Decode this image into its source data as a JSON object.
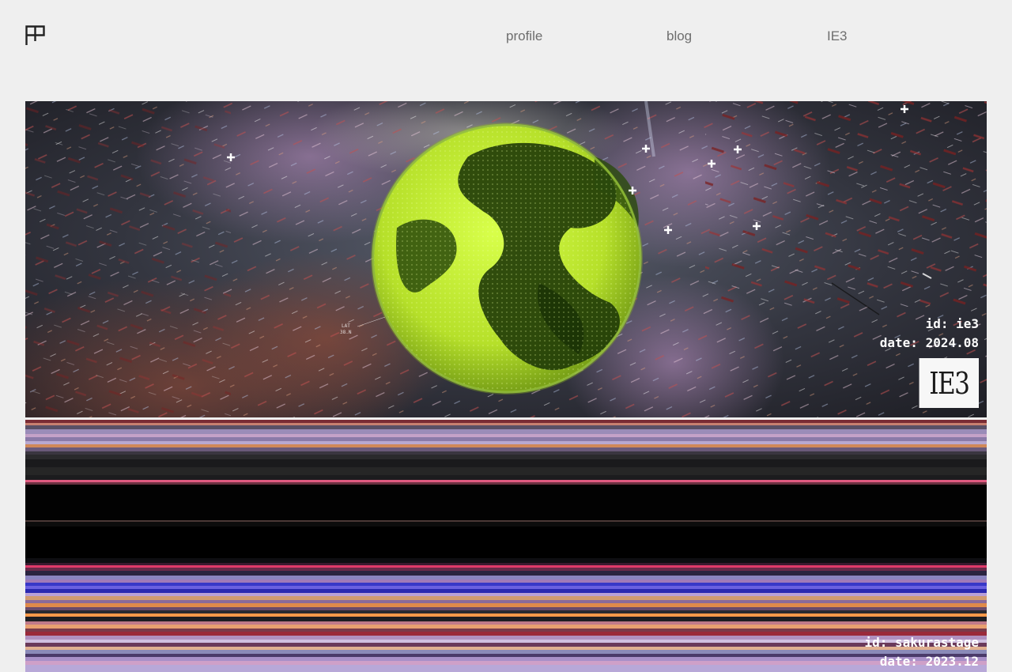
{
  "header": {
    "nav": [
      "profile",
      "blog",
      "IE3"
    ]
  },
  "projects": [
    {
      "id_text": "id: ie3",
      "date_text": "date: 2024.08",
      "badge_text": "IE3"
    },
    {
      "id_text": "id: sakurastage",
      "date_text": "date: 2023.12"
    }
  ],
  "colors": {
    "background": "#efefef",
    "nav_text": "#6e6e6e",
    "globe": "#c8f03a",
    "logo": "#222222"
  },
  "icons": {
    "logo": "cross-grid-logo-icon"
  }
}
